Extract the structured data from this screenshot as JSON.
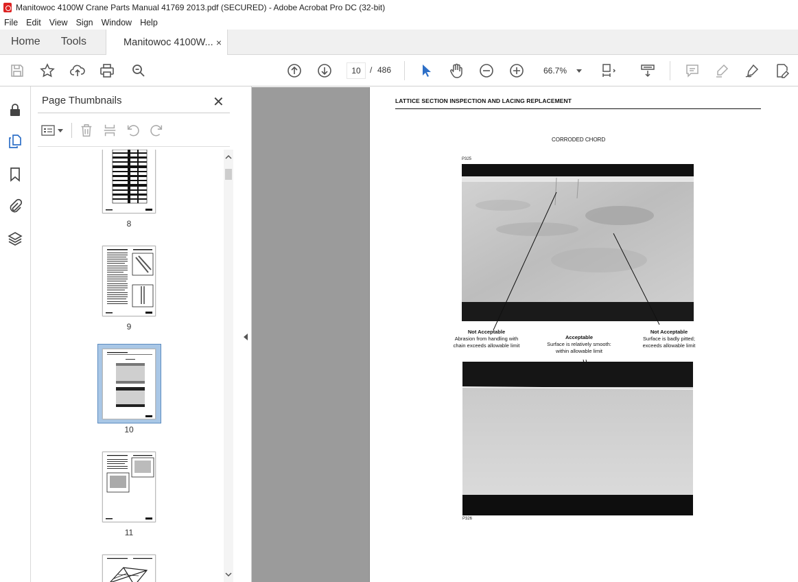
{
  "window": {
    "title": "Manitowoc 4100W Crane Parts Manual 41769 2013.pdf (SECURED) - Adobe Acrobat Pro DC (32-bit)"
  },
  "menu": [
    "File",
    "Edit",
    "View",
    "Sign",
    "Window",
    "Help"
  ],
  "tabs": {
    "home": "Home",
    "tools": "Tools",
    "document": "Manitowoc 4100W...",
    "close": "×"
  },
  "toolbar": {
    "current_page": "10",
    "page_separator": "/",
    "total_pages": "486",
    "zoom": "66.7%"
  },
  "panel": {
    "title": "Page Thumbnails",
    "close": "✕",
    "thumbnails": [
      {
        "label": "8"
      },
      {
        "label": "9"
      },
      {
        "label": "10"
      },
      {
        "label": "11"
      }
    ],
    "selected_page": "10"
  },
  "document": {
    "heading": "LATTICE SECTION INSPECTION AND LACING REPLACEMENT",
    "subheading": "CORRODED CHORD",
    "photo_top_id": "P325",
    "photo_bottom_id": "P326",
    "captions": [
      {
        "title": "Not Acceptable",
        "lines": [
          "Abrasion from handling with",
          "chain exceeds allowable limit"
        ]
      },
      {
        "title": "Acceptable",
        "lines": [
          "Surface is relatively smooth:",
          "within allowable limit"
        ]
      },
      {
        "title": "Not Acceptable",
        "lines": [
          "Surface is badly pitted;",
          "exceeds allowable limit"
        ]
      }
    ]
  },
  "colors": {
    "selection": "#a9c7e6",
    "accent_blue": "#2d6fc7",
    "pdf_red": "#dd2222",
    "canvas_gray": "#9b9b9b"
  }
}
